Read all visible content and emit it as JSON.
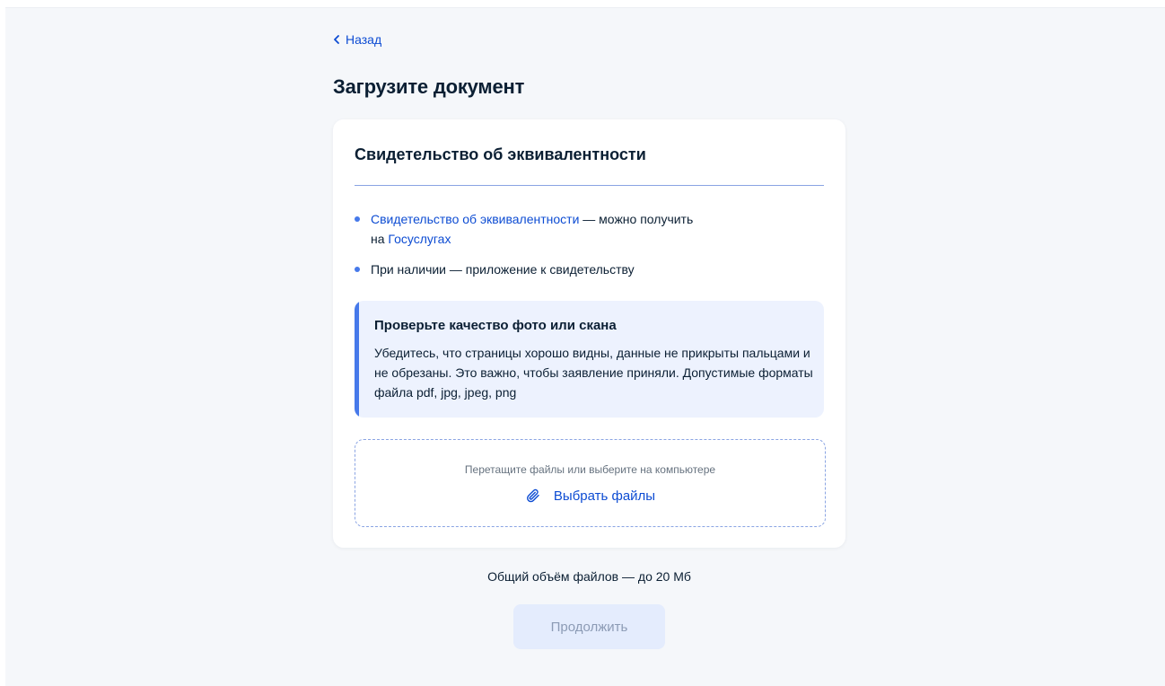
{
  "nav": {
    "back_label": "Назад"
  },
  "page": {
    "title": "Загрузите документ"
  },
  "card": {
    "title": "Свидетельство об эквивалентности",
    "items": [
      {
        "link_text": "Свидетельство об эквивалентности",
        "text_after_link": " — можно получить",
        "text_line2_prefix": "на ",
        "link2_text": "Госуслугах"
      },
      {
        "text": "При наличии — приложение к свидетельству"
      }
    ],
    "notice": {
      "title": "Проверьте качество фото или скана",
      "text": "Убедитесь, что страницы хорошо видны, данные не прикрыты пальцами и не обрезаны. Это важно, чтобы заявление приняли. Допустимые форматы файла pdf, jpg, jpeg, png"
    },
    "dropzone": {
      "hint": "Перетащите файлы или выберите на компьютере",
      "choose_label": "Выбрать файлы",
      "icon": "paperclip-icon"
    }
  },
  "footer": {
    "size_note": "Общий объём файлов — до 20 Мб",
    "continue_label": "Продолжить"
  },
  "colors": {
    "accent": "#0d4cd3",
    "bullet": "#4679ea",
    "notice_bg": "#edf2fe",
    "disabled_button_bg": "#e4ecfd",
    "disabled_button_text": "#8c9bb5"
  }
}
